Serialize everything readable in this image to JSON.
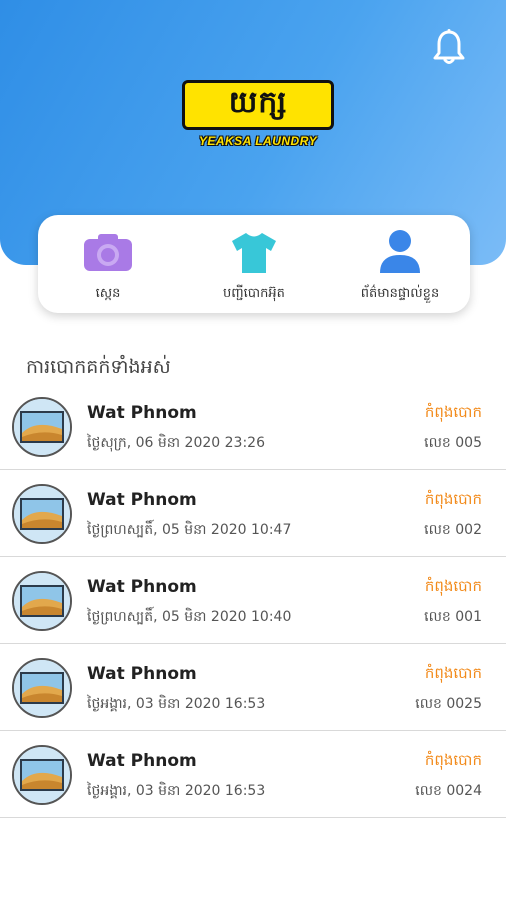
{
  "header": {
    "logo_text": "YEAKSA LAUNDRY",
    "logo_mark": "យក្ស",
    "bell_icon": "bell-icon"
  },
  "menu": [
    {
      "label": "ស្កេន",
      "icon": "camera-icon"
    },
    {
      "label": "បញ្ជីបោកអ៊ុត",
      "icon": "shirt-icon"
    },
    {
      "label": "ព័ត៌មានផ្ទាល់ខ្លួន",
      "icon": "user-icon"
    }
  ],
  "section_title": "ការបោកគក់ទាំងអស់",
  "orders": [
    {
      "title": "Wat Phnom",
      "date": "ថ្ងៃសុក្រ, 06 មិនា 2020 23:26",
      "status": "កំពុងបោក",
      "number": "លេខ 005"
    },
    {
      "title": "Wat Phnom",
      "date": "ថ្ងៃព្រហស្បតិ៍, 05 មិនា 2020 10:47",
      "status": "កំពុងបោក",
      "number": "លេខ 002"
    },
    {
      "title": "Wat Phnom",
      "date": "ថ្ងៃព្រហស្បតិ៍, 05 មិនា 2020 10:40",
      "status": "កំពុងបោក",
      "number": "លេខ 001"
    },
    {
      "title": "Wat Phnom",
      "date": "ថ្ងៃអង្គារ, 03 មិនា 2020 16:53",
      "status": "កំពុងបោក",
      "number": "លេខ 0025"
    },
    {
      "title": "Wat Phnom",
      "date": "ថ្ងៃអង្គារ, 03 មិនា 2020 16:53",
      "status": "កំពុងបោក",
      "number": "លេខ 0024"
    }
  ],
  "colors": {
    "header_start": "#2f8ee6",
    "header_end": "#7bbcf7",
    "status": "#f28a1a",
    "camera": "#a97ae6",
    "shirt": "#38c7d8",
    "user": "#3a86e8"
  }
}
